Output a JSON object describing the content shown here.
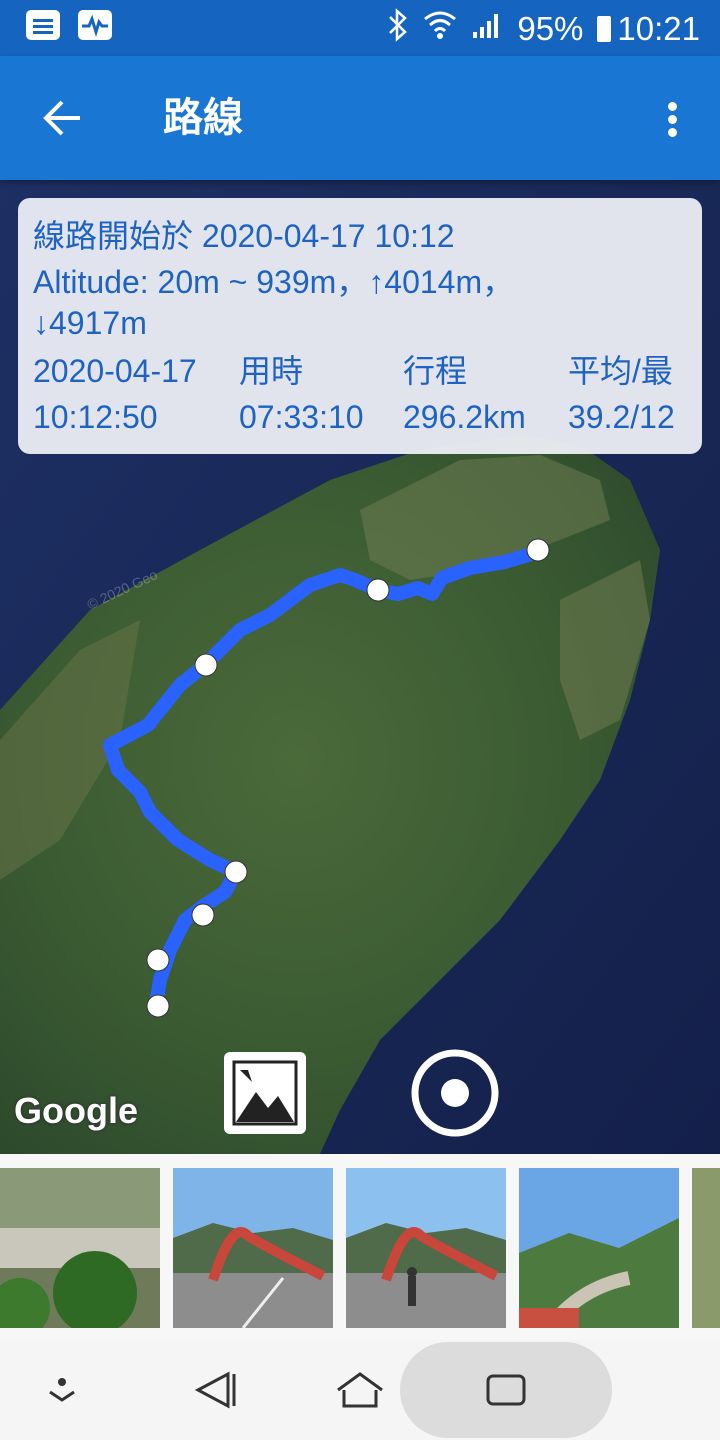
{
  "status_bar": {
    "left_icons": [
      "notes-icon",
      "activity-icon"
    ],
    "right_icons": [
      "bluetooth-icon",
      "wifi-icon",
      "signal-icon",
      "battery-icon"
    ],
    "battery": "95%",
    "time": "10:21"
  },
  "app_bar": {
    "title": "路線",
    "back_icon": "arrow-back-icon",
    "menu_icon": "more-vert-icon"
  },
  "route_info": {
    "start_line": "線路開始於 2020-04-17 10:12",
    "altitude_line": "Altitude: 20m ~ 939m，↑4014m，",
    "descent_line": "↓4917m",
    "stats": [
      {
        "label": "2020-04-17",
        "value": "10:12:50"
      },
      {
        "label": "用時",
        "value": "07:33:10"
      },
      {
        "label": "行程",
        "value": "296.2km"
      },
      {
        "label": "平均/最",
        "value": "39.2/12"
      }
    ]
  },
  "map": {
    "provider_label": "Google",
    "watermark": "© 2020 Geo",
    "route_color": "#2962ff"
  },
  "thumbnails": [
    "cliff-road-photo",
    "red-bridge-photo",
    "red-bridge-person-photo",
    "river-valley-photo",
    "partial-photo"
  ],
  "nav_bar": {
    "icons": [
      "nav-expand-icon",
      "nav-back-icon",
      "nav-home-icon",
      "nav-recents-icon"
    ]
  },
  "colors": {
    "primary": "#1976d2",
    "primary_dark": "#1565c0",
    "info_text": "#1e63c2"
  }
}
